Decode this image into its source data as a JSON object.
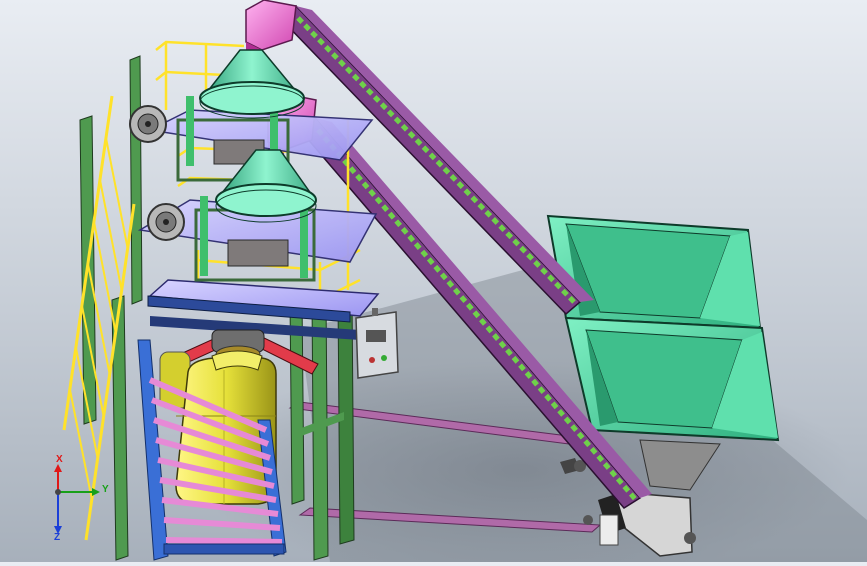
{
  "viewport": {
    "colors": {
      "background_top": "#e9edf3",
      "background_bottom": "#a7b0bb",
      "steel_green": "#4f9a4f",
      "steel_green_dark": "#2f6e34",
      "conveyor_purple": "#7a3f86",
      "conveyor_purple_dark": "#4a2052",
      "hopper_teal": "#52d6a2",
      "bag_yellow": "#e8e33c",
      "railing_yellow": "#ffe22a",
      "platform_lavender": "#b9b4ff",
      "pink_head": "#ff6bd6"
    }
  },
  "triad": {
    "x_label": "X",
    "y_label": "Y",
    "z_label": "Z",
    "colors": {
      "x": "#e01818",
      "y": "#18a018",
      "z": "#1b3fd8"
    }
  }
}
